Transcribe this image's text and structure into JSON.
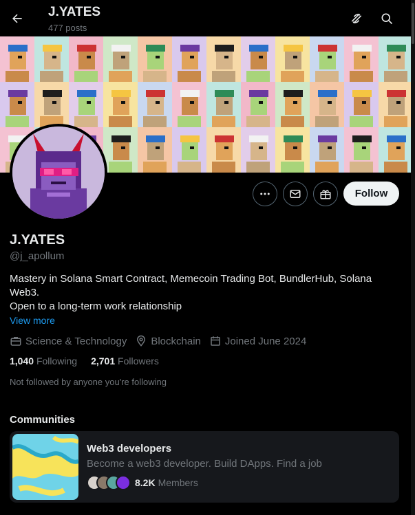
{
  "header": {
    "title": "J.YATES",
    "posts_count": "477 posts"
  },
  "profile": {
    "name": "J.YATES",
    "handle": "@j_apollum",
    "bio_line1": "Mastery in Solana Smart Contract, Memecoin Trading Bot, BundlerHub, Solana Web3.",
    "bio_line2": "Open to a long-term work relationship",
    "view_more": "View more",
    "category": "Science & Technology",
    "location": "Blockchain",
    "joined": "Joined June 2024",
    "following_count": "1,040",
    "following_label": "Following",
    "followers_count": "2,701",
    "followers_label": "Followers",
    "not_followed": "Not followed by anyone you're following"
  },
  "actions": {
    "follow_label": "Follow"
  },
  "communities": {
    "heading": "Communities",
    "items": [
      {
        "name": "Web3 developers",
        "description": "Become a web3 developer. Build DApps. Find a job",
        "members_count": "8.2K",
        "members_label": "Members"
      }
    ]
  },
  "icons": {
    "back": "arrow-left-icon",
    "grok": "grok-icon",
    "search": "search-icon",
    "more": "more-icon",
    "message": "mail-icon",
    "subscribe": "gift-icon",
    "category": "briefcase-icon",
    "location": "location-pin-icon",
    "joined": "calendar-icon"
  },
  "colors": {
    "background": "#000000",
    "text": "#e7e9ea",
    "muted": "#71767b",
    "link": "#1d9bf0",
    "card": "#16181c"
  }
}
